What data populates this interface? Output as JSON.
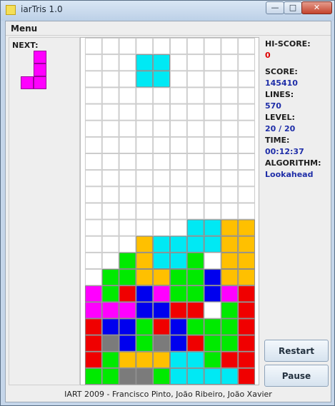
{
  "window": {
    "title": "iarTris 1.0",
    "min_symbol": "—",
    "max_symbol": "□",
    "close_symbol": "✕"
  },
  "menu": {
    "label": "Menu"
  },
  "next": {
    "label": "NEXT:",
    "cells": [
      [
        0,
        1
      ],
      [
        0,
        1
      ],
      [
        1,
        1
      ]
    ],
    "color": "#ff00ff"
  },
  "board": {
    "cols": 10,
    "rows": 20,
    "palette": {
      "C": "#00e9f4",
      "Y": "#ffc000",
      "G": "#00ea00",
      "B": "#0000ee",
      "R": "#f00000",
      "M": "#ff00ff",
      "S": "#7b7b7b"
    },
    "cells": [
      "..........",
      "...CC.....",
      "...CC.....",
      "..........",
      "..........",
      "..........",
      "..........",
      "..........",
      "..........",
      "..........",
      "..........",
      "......CCYY",
      "...YCCCCYY",
      "..GYCCG.YY",
      ".GGYYGGBYY",
      "MGRBMGGBMR",
      "MMMBBRR.GR",
      "RBBGRBGGGR",
      "RSBGSBRGGR",
      "RGYYYCCGRR",
      "GGSSGCCCCR"
    ]
  },
  "stats": {
    "hiscore_label": "HI-SCORE:",
    "hiscore_value": "0",
    "score_label": "SCORE:",
    "score_value": "145410",
    "lines_label": "LINES:",
    "lines_value": "570",
    "level_label": "LEVEL:",
    "level_value": "20 / 20",
    "time_label": "TIME:",
    "time_value": "00:12:37",
    "algorithm_label": "ALGORITHM:",
    "algorithm_value": "Lookahead"
  },
  "buttons": {
    "restart": "Restart",
    "pause": "Pause"
  },
  "status": "IART 2009 - Francisco Pinto, João Ribeiro, João Xavier"
}
